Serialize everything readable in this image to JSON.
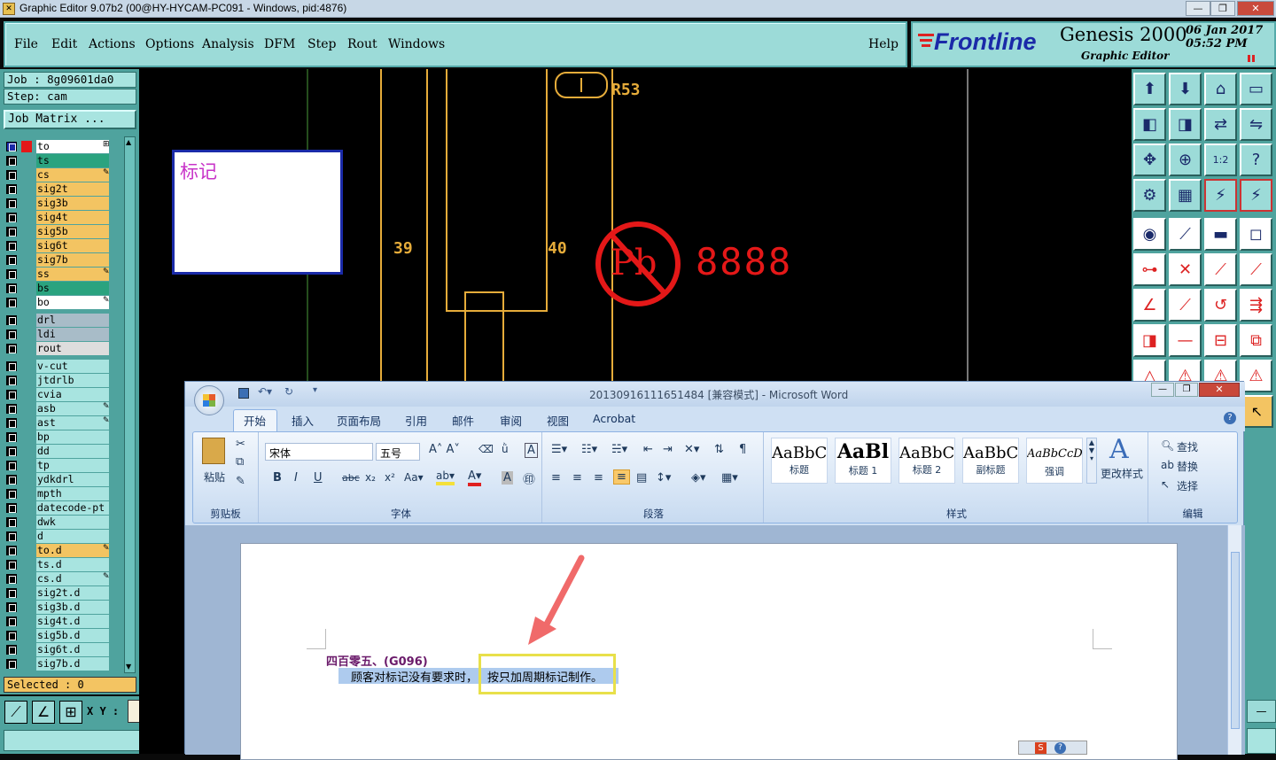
{
  "titlebar": {
    "title": "Graphic Editor 9.07b2 (00@HY-HYCAM-PC091 - Windows, pid:4876)",
    "min": "—",
    "max": "❐",
    "close": "✕"
  },
  "menu": [
    "File",
    "Edit",
    "Actions",
    "Options",
    "Analysis",
    "DFM",
    "Step",
    "Rout",
    "Windows"
  ],
  "help": "Help",
  "brand": {
    "logo": "Frontline",
    "product": "Genesis 2000",
    "subtitle": "Graphic Editor",
    "date": "06 Jan 2017",
    "time": "05:52 PM"
  },
  "job": {
    "job": "Job : 8g09601da0",
    "step": "Step: cam",
    "matrix": "Job Matrix ..."
  },
  "layers": [
    {
      "name": "to",
      "color": "#ffffff",
      "mark": "⊞"
    },
    {
      "name": "ts",
      "color": "#2aa37f",
      "mark": ""
    },
    {
      "name": "cs",
      "color": "#f3c462",
      "mark": "✎"
    },
    {
      "name": "sig2t",
      "color": "#f3c462",
      "mark": ""
    },
    {
      "name": "sig3b",
      "color": "#f3c462",
      "mark": ""
    },
    {
      "name": "sig4t",
      "color": "#f3c462",
      "mark": ""
    },
    {
      "name": "sig5b",
      "color": "#f3c462",
      "mark": ""
    },
    {
      "name": "sig6t",
      "color": "#f3c462",
      "mark": ""
    },
    {
      "name": "sig7b",
      "color": "#f3c462",
      "mark": ""
    },
    {
      "name": "ss",
      "color": "#f3c462",
      "mark": "✎"
    },
    {
      "name": "bs",
      "color": "#2aa37f",
      "mark": ""
    },
    {
      "name": "bo",
      "color": "#ffffff",
      "mark": "✎"
    },
    {
      "name": "drl",
      "color": "#a8bcc8",
      "mark": ""
    },
    {
      "name": "ldi",
      "color": "#a8bcc8",
      "mark": ""
    },
    {
      "name": "rout",
      "color": "#dddddd",
      "mark": ""
    },
    {
      "name": "v-cut",
      "color": "#a8e4e0",
      "mark": ""
    },
    {
      "name": "jtdrlb",
      "color": "#a8e4e0",
      "mark": ""
    },
    {
      "name": "cvia",
      "color": "#a8e4e0",
      "mark": ""
    },
    {
      "name": "asb",
      "color": "#a8e4e0",
      "mark": "✎"
    },
    {
      "name": "ast",
      "color": "#a8e4e0",
      "mark": "✎"
    },
    {
      "name": "bp",
      "color": "#a8e4e0",
      "mark": ""
    },
    {
      "name": "dd",
      "color": "#a8e4e0",
      "mark": ""
    },
    {
      "name": "tp",
      "color": "#a8e4e0",
      "mark": ""
    },
    {
      "name": "ydkdrl",
      "color": "#a8e4e0",
      "mark": ""
    },
    {
      "name": "mpth",
      "color": "#a8e4e0",
      "mark": ""
    },
    {
      "name": "datecode-pt",
      "color": "#a8e4e0",
      "mark": ""
    },
    {
      "name": "dwk",
      "color": "#a8e4e0",
      "mark": ""
    },
    {
      "name": "d",
      "color": "#a8e4e0",
      "mark": ""
    },
    {
      "name": "to.d",
      "color": "#f3c462",
      "mark": "✎"
    },
    {
      "name": "ts.d",
      "color": "#a8e4e0",
      "mark": ""
    },
    {
      "name": "cs.d",
      "color": "#a8e4e0",
      "mark": "✎"
    },
    {
      "name": "sig2t.d",
      "color": "#a8e4e0",
      "mark": ""
    },
    {
      "name": "sig3b.d",
      "color": "#a8e4e0",
      "mark": ""
    },
    {
      "name": "sig4t.d",
      "color": "#a8e4e0",
      "mark": ""
    },
    {
      "name": "sig5b.d",
      "color": "#a8e4e0",
      "mark": ""
    },
    {
      "name": "sig6t.d",
      "color": "#a8e4e0",
      "mark": ""
    },
    {
      "name": "sig7b.d",
      "color": "#a8e4e0",
      "mark": ""
    }
  ],
  "selected": "Selected : 0",
  "xy": "X Y :",
  "canvas": {
    "label_box": "标记",
    "n39": "39",
    "n40": "40",
    "r53": "R53",
    "pb": "Pb",
    "digits": "8888"
  },
  "word": {
    "title": "20130916111651484 [兼容模式] - Microsoft Word",
    "tabs": [
      "开始",
      "插入",
      "页面布局",
      "引用",
      "邮件",
      "审阅",
      "视图",
      "Acrobat"
    ],
    "paste": "粘贴",
    "font": "宋体",
    "size": "五号",
    "groups": [
      "剪贴板",
      "字体",
      "段落",
      "样式",
      "编辑"
    ],
    "styles": [
      {
        "sample": "AaBbC",
        "name": "标题"
      },
      {
        "sample": "AaBl",
        "name": "标题 1"
      },
      {
        "sample": "AaBbC",
        "name": "标题 2"
      },
      {
        "sample": "AaBbC",
        "name": "副标题"
      },
      {
        "sample": "AaBbCcD",
        "name": "强调"
      }
    ],
    "change_style": "更改样式",
    "find": "查找",
    "replace": "替换",
    "select": "选择",
    "heading": "四百零五、(G096)",
    "body_a": "顾客对标记没有要求时，",
    "body_b": "按只加周期标记制作。"
  }
}
